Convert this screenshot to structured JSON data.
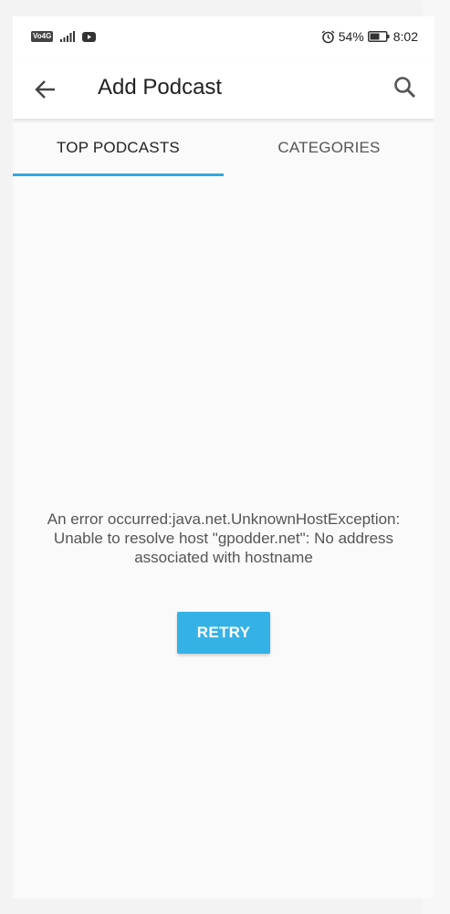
{
  "status_bar": {
    "network_badge": "Vo4G",
    "battery_percent": "54%",
    "time": "8:02",
    "icons": [
      "volte-icon",
      "signal-icon",
      "youtube-icon",
      "alarm-icon",
      "battery-icon"
    ]
  },
  "app_bar": {
    "title": "Add Podcast",
    "back_icon": "arrow-left-icon",
    "search_icon": "search-icon"
  },
  "tabs": [
    {
      "label": "TOP PODCASTS",
      "selected": true
    },
    {
      "label": "CATEGORIES",
      "selected": false
    }
  ],
  "content": {
    "error_message": "An error occurred:java.net.UnknownHostException: Unable to resolve host \"gpodder.net\": No address associated with hostname",
    "retry_label": "RETRY"
  },
  "colors": {
    "accent": "#35a6dc",
    "button": "#35b2e5",
    "background": "#fafafa"
  }
}
